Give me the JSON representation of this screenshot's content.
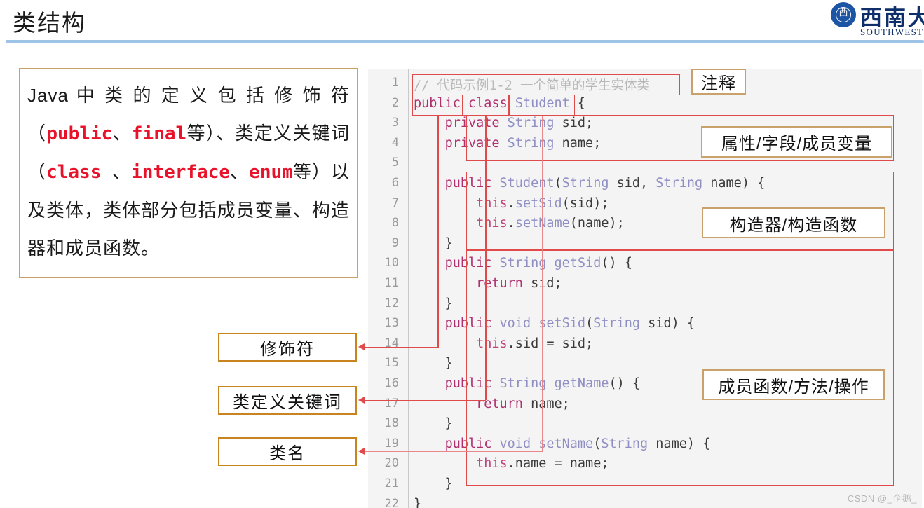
{
  "header": {
    "title": "类结构",
    "logo": {
      "emblem_glyph": "西",
      "name_cn": "西南大学",
      "name_en": "SOUTHWEST UNIVERSITY",
      "color": "#0f2f6b"
    },
    "rule_color": "#9dc3e6"
  },
  "description": {
    "segments": [
      {
        "text": "Java 中 类 的 定 义 包 括 修 饰 符 （",
        "kw": false
      },
      {
        "text": "public",
        "kw": true
      },
      {
        "text": "、",
        "kw": false
      },
      {
        "text": "final",
        "kw": true
      },
      {
        "text": "等）、类定义关键词（",
        "kw": false
      },
      {
        "text": "class ",
        "kw": true
      },
      {
        "text": "、",
        "kw": false
      },
      {
        "text": "interface",
        "kw": true
      },
      {
        "text": "、",
        "kw": false
      },
      {
        "text": "enum",
        "kw": true
      },
      {
        "text": "等）以及类体，类体部分包括成员变量、构造器和成员函数。",
        "kw": false
      }
    ],
    "plain": "Java 中类的定义包括修饰符（public、final等）、类定义关键词（class 、interface、enum等）以及类体，类体部分包括成员变量、构造器和成员函数。",
    "keyword_color": "#e8132a",
    "border_color": "#c8a26a"
  },
  "code": {
    "line_numbers": [
      "1",
      "2",
      "3",
      "4",
      "5",
      "6",
      "7",
      "8",
      "9",
      "10",
      "11",
      "12",
      "13",
      "14",
      "15",
      "16",
      "17",
      "18",
      "19",
      "20",
      "21",
      "22"
    ],
    "lines": [
      {
        "n": 1,
        "tokens": [
          {
            "t": "// 代码示例1-2 一个简单的学生实体类",
            "c": "c-com"
          }
        ]
      },
      {
        "n": 2,
        "tokens": [
          {
            "t": "public",
            "c": "c-kw"
          },
          {
            "t": " ",
            "c": "c-id"
          },
          {
            "t": "class",
            "c": "c-kw"
          },
          {
            "t": " ",
            "c": "c-id"
          },
          {
            "t": "Student",
            "c": "c-type"
          },
          {
            "t": " {",
            "c": "c-id"
          }
        ]
      },
      {
        "n": 3,
        "tokens": [
          {
            "t": "    ",
            "c": "c-id"
          },
          {
            "t": "private",
            "c": "c-kw"
          },
          {
            "t": " ",
            "c": "c-id"
          },
          {
            "t": "String",
            "c": "c-type"
          },
          {
            "t": " sid;",
            "c": "c-id"
          }
        ]
      },
      {
        "n": 4,
        "tokens": [
          {
            "t": "    ",
            "c": "c-id"
          },
          {
            "t": "private",
            "c": "c-kw"
          },
          {
            "t": " ",
            "c": "c-id"
          },
          {
            "t": "String",
            "c": "c-type"
          },
          {
            "t": " name;",
            "c": "c-id"
          }
        ]
      },
      {
        "n": 5,
        "tokens": []
      },
      {
        "n": 6,
        "tokens": [
          {
            "t": "    ",
            "c": "c-id"
          },
          {
            "t": "public",
            "c": "c-kw"
          },
          {
            "t": " ",
            "c": "c-id"
          },
          {
            "t": "Student",
            "c": "c-type"
          },
          {
            "t": "(",
            "c": "c-id"
          },
          {
            "t": "String",
            "c": "c-type"
          },
          {
            "t": " sid, ",
            "c": "c-id"
          },
          {
            "t": "String",
            "c": "c-type"
          },
          {
            "t": " name) {",
            "c": "c-id"
          }
        ]
      },
      {
        "n": 7,
        "tokens": [
          {
            "t": "        ",
            "c": "c-id"
          },
          {
            "t": "this",
            "c": "c-this"
          },
          {
            "t": ".",
            "c": "c-id"
          },
          {
            "t": "setSid",
            "c": "c-type"
          },
          {
            "t": "(sid);",
            "c": "c-id"
          }
        ]
      },
      {
        "n": 8,
        "tokens": [
          {
            "t": "        ",
            "c": "c-id"
          },
          {
            "t": "this",
            "c": "c-this"
          },
          {
            "t": ".",
            "c": "c-id"
          },
          {
            "t": "setName",
            "c": "c-type"
          },
          {
            "t": "(name);",
            "c": "c-id"
          }
        ]
      },
      {
        "n": 9,
        "tokens": [
          {
            "t": "    }",
            "c": "c-id"
          }
        ]
      },
      {
        "n": 10,
        "tokens": [
          {
            "t": "    ",
            "c": "c-id"
          },
          {
            "t": "public",
            "c": "c-kw"
          },
          {
            "t": " ",
            "c": "c-id"
          },
          {
            "t": "String",
            "c": "c-type"
          },
          {
            "t": " ",
            "c": "c-id"
          },
          {
            "t": "getSid",
            "c": "c-type"
          },
          {
            "t": "() {",
            "c": "c-id"
          }
        ]
      },
      {
        "n": 11,
        "tokens": [
          {
            "t": "        ",
            "c": "c-id"
          },
          {
            "t": "return",
            "c": "c-kw"
          },
          {
            "t": " sid;",
            "c": "c-id"
          }
        ]
      },
      {
        "n": 12,
        "tokens": [
          {
            "t": "    }",
            "c": "c-id"
          }
        ]
      },
      {
        "n": 13,
        "tokens": [
          {
            "t": "    ",
            "c": "c-id"
          },
          {
            "t": "public",
            "c": "c-kw"
          },
          {
            "t": " ",
            "c": "c-id"
          },
          {
            "t": "void",
            "c": "c-type"
          },
          {
            "t": " ",
            "c": "c-id"
          },
          {
            "t": "setSid",
            "c": "c-type"
          },
          {
            "t": "(",
            "c": "c-id"
          },
          {
            "t": "String",
            "c": "c-type"
          },
          {
            "t": " sid) {",
            "c": "c-id"
          }
        ]
      },
      {
        "n": 14,
        "tokens": [
          {
            "t": "        ",
            "c": "c-id"
          },
          {
            "t": "this",
            "c": "c-this"
          },
          {
            "t": ".sid = sid;",
            "c": "c-id"
          }
        ]
      },
      {
        "n": 15,
        "tokens": [
          {
            "t": "    }",
            "c": "c-id"
          }
        ]
      },
      {
        "n": 16,
        "tokens": [
          {
            "t": "    ",
            "c": "c-id"
          },
          {
            "t": "public",
            "c": "c-kw"
          },
          {
            "t": " ",
            "c": "c-id"
          },
          {
            "t": "String",
            "c": "c-type"
          },
          {
            "t": " ",
            "c": "c-id"
          },
          {
            "t": "getName",
            "c": "c-type"
          },
          {
            "t": "() {",
            "c": "c-id"
          }
        ]
      },
      {
        "n": 17,
        "tokens": [
          {
            "t": "        ",
            "c": "c-id"
          },
          {
            "t": "return",
            "c": "c-kw"
          },
          {
            "t": " name;",
            "c": "c-id"
          }
        ]
      },
      {
        "n": 18,
        "tokens": [
          {
            "t": "    }",
            "c": "c-id"
          }
        ]
      },
      {
        "n": 19,
        "tokens": [
          {
            "t": "    ",
            "c": "c-id"
          },
          {
            "t": "public",
            "c": "c-kw"
          },
          {
            "t": " ",
            "c": "c-id"
          },
          {
            "t": "void",
            "c": "c-type"
          },
          {
            "t": " ",
            "c": "c-id"
          },
          {
            "t": "setName",
            "c": "c-type"
          },
          {
            "t": "(",
            "c": "c-id"
          },
          {
            "t": "String",
            "c": "c-type"
          },
          {
            "t": " name) {",
            "c": "c-id"
          }
        ]
      },
      {
        "n": 20,
        "tokens": [
          {
            "t": "        ",
            "c": "c-id"
          },
          {
            "t": "this",
            "c": "c-this"
          },
          {
            "t": ".name = name;",
            "c": "c-id"
          }
        ]
      },
      {
        "n": 21,
        "tokens": [
          {
            "t": "    }",
            "c": "c-id"
          }
        ]
      },
      {
        "n": 22,
        "tokens": [
          {
            "t": "}",
            "c": "c-id"
          }
        ]
      }
    ]
  },
  "annotations": {
    "right_labels": [
      {
        "id": "comment",
        "text": "注释"
      },
      {
        "id": "field",
        "text": "属性/字段/成员变量"
      },
      {
        "id": "constructor",
        "text": "构造器/构造函数"
      },
      {
        "id": "method",
        "text": "成员函数/方法/操作"
      }
    ],
    "left_callouts": [
      {
        "id": "modifier",
        "text": "修饰符"
      },
      {
        "id": "class-kw",
        "text": "类定义关键词"
      },
      {
        "id": "class-name",
        "text": "类名"
      }
    ],
    "highlight_color": "#e04a4a",
    "label_border_color": "#c8a26a"
  },
  "watermark": "CSDN @_企鹅_"
}
